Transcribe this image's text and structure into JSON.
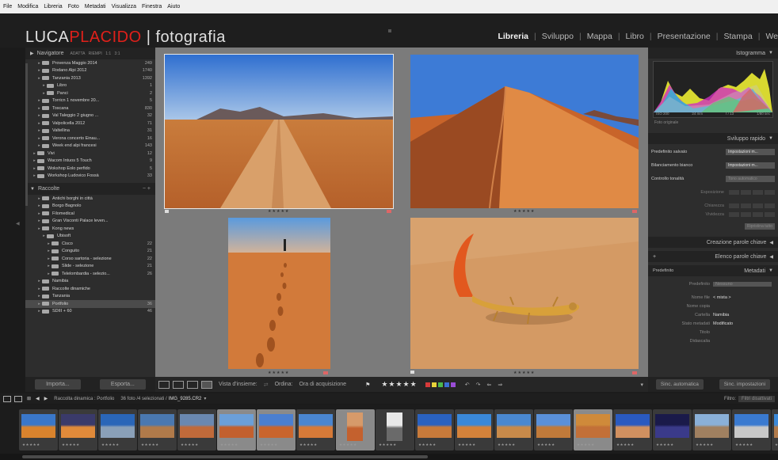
{
  "menu": [
    "File",
    "Modifica",
    "Libreria",
    "Foto",
    "Metadati",
    "Visualizza",
    "Finestra",
    "Aiuto"
  ],
  "identity": {
    "part1": "LUCA",
    "part2": "PLACIDO",
    "part3": " | fotografia"
  },
  "modules": [
    {
      "label": "Libreria",
      "active": true
    },
    {
      "label": "Sviluppo"
    },
    {
      "label": "Mappa"
    },
    {
      "label": "Libro"
    },
    {
      "label": "Presentazione"
    },
    {
      "label": "Stampa"
    },
    {
      "label": "We"
    }
  ],
  "left": {
    "navigator_title": "Navigatore",
    "navigator_modes": "ADATTA  RIEMPI  1:1  3:1",
    "folders": [
      {
        "label": "Provenza Maggio 2014",
        "count": "249",
        "indent": 1
      },
      {
        "label": "Rodano Alpi 2012",
        "count": "1740",
        "indent": 1
      },
      {
        "label": "Tanzania 2013",
        "count": "1392",
        "indent": 1
      },
      {
        "label": "Libro",
        "count": "1",
        "indent": 2
      },
      {
        "label": "Panci",
        "count": "2",
        "indent": 2
      },
      {
        "label": "Torricn 1 novembre 20...",
        "count": "5",
        "indent": 1
      },
      {
        "label": "Toscana",
        "count": "830",
        "indent": 1
      },
      {
        "label": "Val Taleggio 2 giugno ...",
        "count": "32",
        "indent": 1
      },
      {
        "label": "Valpolicella 2012",
        "count": "71",
        "indent": 1
      },
      {
        "label": "Valtellina",
        "count": "31",
        "indent": 1
      },
      {
        "label": "Verona concerto Einau...",
        "count": "16",
        "indent": 1
      },
      {
        "label": "Week end alpi francesi",
        "count": "143",
        "indent": 1
      },
      {
        "label": "Vivi",
        "count": "12",
        "indent": 0
      },
      {
        "label": "Wacom Intuos 5 Touch",
        "count": "9",
        "indent": 0
      },
      {
        "label": "Wokshop Eolo perfido",
        "count": "5",
        "indent": 0
      },
      {
        "label": "Workshop Ludovico Fossà",
        "count": "33",
        "indent": 0
      }
    ],
    "collections_title": "Raccolte",
    "collections": [
      {
        "label": "Antichi borghi in città",
        "count": "",
        "indent": 1
      },
      {
        "label": "Borgo Bagnolo",
        "count": "",
        "indent": 1
      },
      {
        "label": "Filomedical",
        "count": "",
        "indent": 1
      },
      {
        "label": "Gran Visconti Palace leven...",
        "count": "",
        "indent": 1
      },
      {
        "label": "Kong news",
        "count": "",
        "indent": 1
      },
      {
        "label": "Ubisoft",
        "count": "",
        "indent": 2
      },
      {
        "label": "Cisco",
        "count": "22",
        "indent": 3
      },
      {
        "label": "Conguito",
        "count": "21",
        "indent": 3
      },
      {
        "label": "Corso sartoria - selezione",
        "count": "22",
        "indent": 3
      },
      {
        "label": "Slide - selezione",
        "count": "21",
        "indent": 3
      },
      {
        "label": "Telelombardia - selezio...",
        "count": "26",
        "indent": 3
      },
      {
        "label": "Namibia",
        "count": "",
        "indent": 1
      },
      {
        "label": "Raccolte dinamiche",
        "count": "",
        "indent": 1
      },
      {
        "label": "Tanzania",
        "count": "",
        "indent": 1
      },
      {
        "label": "Portfolio",
        "count": "36",
        "indent": 1,
        "selected": true
      },
      {
        "label": "SDIII + 60",
        "count": "46",
        "indent": 1
      }
    ],
    "import_label": "Importa...",
    "export_label": "Esporta..."
  },
  "toolbar": {
    "survey_label": "Vista d'insieme:",
    "sort_label": "Ordina:",
    "sort_value": "Ora di acquisizione",
    "stars": "★★★★★",
    "flag_colors": [
      "#d63a3a",
      "#e8d23a",
      "#4db84d",
      "#3a6fd6",
      "#9a4dd6"
    ]
  },
  "right": {
    "histogram_title": "Istogramma",
    "exif": [
      "ISO 200",
      "24 mm",
      "f / 13",
      "1/80 sec"
    ],
    "original_photo": "Foto originale",
    "quick_develop_title": "Sviluppo rapido",
    "saved_preset_label": "Predefinito salvato",
    "saved_preset_value": "Impostazioni m...",
    "white_balance_label": "Bilanciamento bianco",
    "white_balance_value": "Impostazioni m...",
    "tone_control_label": "Controllo tonalità",
    "tone_control_value": "Tono automatico",
    "exposure_label": "Esposizione",
    "clarity_label": "Chiarezza",
    "vibrance_label": "Vividezza",
    "reset_label": "Ripristina tutto",
    "keywording_title": "Creazione parole chiave",
    "keyword_list_title": "Elenco parole chiave",
    "metadata_preset": "Predefinito",
    "metadata_title": "Metadati",
    "preset_label": "Predefinito",
    "preset_value": "Nessuno",
    "metadata_rows": [
      {
        "key": "Nome file",
        "value": "< mista >"
      },
      {
        "key": "Nome copia",
        "value": ""
      },
      {
        "key": "Cartella",
        "value": "Namibia"
      },
      {
        "key": "Stato metadati",
        "value": "Modificato"
      },
      {
        "key": "Titolo",
        "value": ""
      },
      {
        "key": "Didascalia",
        "value": ""
      }
    ],
    "sync_auto_label": "Sinc. automatica",
    "sync_settings_label": "Sinc. impostazioni"
  },
  "filmstrip_bar": {
    "breadcrumb": "Raccolta dinamica : Portfolio",
    "selection": "36 foto /4 selezionati /",
    "filename": "IMG_9285.CR2",
    "filter_label": "Filtro:",
    "filter_value": "Filtri disattivati"
  },
  "filmstrip_thumbs": [
    {
      "colors": [
        "#3a77c9",
        "#d9832d"
      ]
    },
    {
      "colors": [
        "#3a3a6a",
        "#e08a3a"
      ]
    },
    {
      "colors": [
        "#2a66b8",
        "#8aa0b8"
      ]
    },
    {
      "colors": [
        "#4a78b0",
        "#b07a4a"
      ]
    },
    {
      "colors": [
        "#6a88b0",
        "#c06a3a"
      ]
    },
    {
      "colors": [
        "#6b9fd8",
        "#c2602e"
      ],
      "selected": true
    },
    {
      "colors": [
        "#4b7fd0",
        "#c9652d"
      ],
      "selected": true
    },
    {
      "colors": [
        "#4a86d0",
        "#d67a38"
      ]
    },
    {
      "colors": [
        "#d69a6a",
        "#c4612e"
      ],
      "selected": true,
      "portrait": true
    },
    {
      "colors": [
        "#e8e8e8",
        "#6a6a6a"
      ],
      "portrait": true
    },
    {
      "colors": [
        "#2a62c0",
        "#c87a3a"
      ]
    },
    {
      "colors": [
        "#3a88d8",
        "#d4823a"
      ]
    },
    {
      "colors": [
        "#4a88d0",
        "#c88a4a"
      ]
    },
    {
      "colors": [
        "#5a90d8",
        "#c07a3a"
      ]
    },
    {
      "colors": [
        "#cf8a3a",
        "#c27038"
      ],
      "selected": true
    },
    {
      "colors": [
        "#2a5ac0",
        "#d09060"
      ]
    },
    {
      "colors": [
        "#1a1a4a",
        "#3a3a8a"
      ]
    },
    {
      "colors": [
        "#8ab0d8",
        "#a08060"
      ]
    },
    {
      "colors": [
        "#3a7ad0",
        "#c8c8c8"
      ]
    },
    {
      "colors": [
        "#3a88d8",
        "#b07a4a"
      ]
    }
  ],
  "center": {
    "stars": "★★★★★"
  }
}
